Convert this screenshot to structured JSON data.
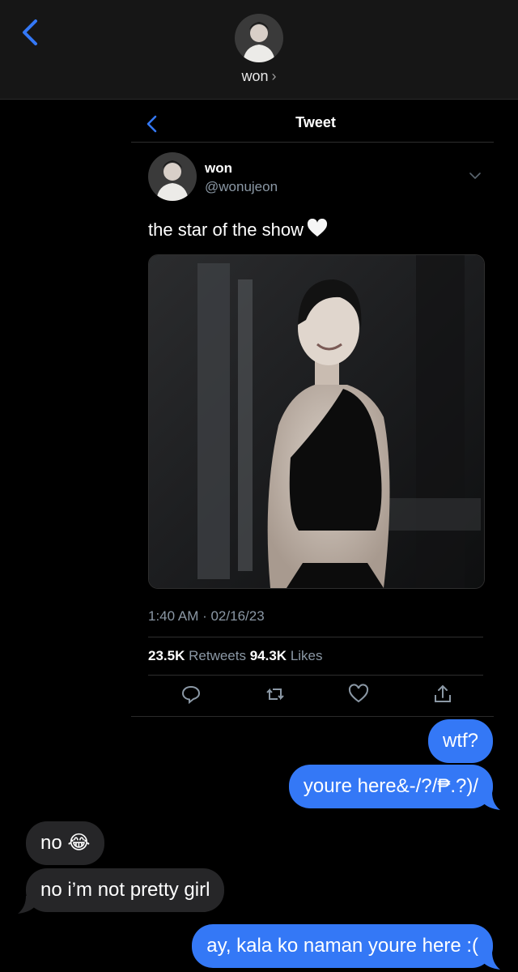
{
  "header": {
    "contact_name": "won",
    "chevron": "›",
    "back_icon": "chevron-left-icon"
  },
  "tweet": {
    "nav_title": "Tweet",
    "author_name": "won",
    "author_handle": "@wonujeon",
    "text": "the star of the show",
    "emoji": "white-heart",
    "timestamp": "1:40 AM · 02/16/23",
    "retweets_count": "23.5K",
    "retweets_label": "Retweets",
    "likes_count": "94.3K",
    "likes_label": "Likes",
    "actions": [
      "reply-icon",
      "retweet-icon",
      "like-icon",
      "share-icon"
    ]
  },
  "messages": [
    {
      "from": "me",
      "text": "wtf?"
    },
    {
      "from": "me",
      "text": "youre here&-/?/₱.?)/"
    },
    {
      "from": "them",
      "text": "no 😂"
    },
    {
      "from": "them",
      "text": "no i’m not pretty girl"
    },
    {
      "from": "me",
      "text": "ay, kala ko naman youre here :("
    }
  ],
  "colors": {
    "accent_blue": "#3478f6",
    "incoming_bubble": "#262628",
    "twitter_gray": "#8b98a5",
    "background": "#000000"
  }
}
